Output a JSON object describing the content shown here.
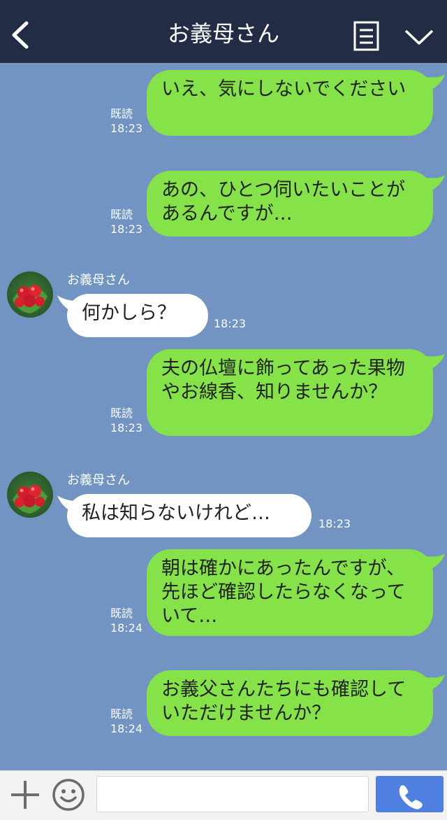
{
  "header": {
    "title": "お義母さん",
    "back_icon": "chevron-left-icon",
    "menu_icon": "notes-menu-icon",
    "more_icon": "chevron-down-icon"
  },
  "messages": [
    {
      "side": "me",
      "text": "いえ、気にしないでください",
      "read": "既読",
      "time": "18:23"
    },
    {
      "side": "me",
      "text": "あの、ひとつ伺いたいことがあるんですが…",
      "read": "既読",
      "time": "18:23"
    },
    {
      "side": "them",
      "sender": "お義母さん",
      "text": "何かしら？",
      "time": "18:23"
    },
    {
      "side": "me",
      "text": "夫の仏壇に飾ってあった果物やお線香、知りませんか？",
      "read": "既読",
      "time": "18:23"
    },
    {
      "side": "them",
      "sender": "お義母さん",
      "text": "私は知らないけれど…",
      "time": "18:23"
    },
    {
      "side": "me",
      "text": "朝は確かにあったんですが、先ほど確認したらなくなっていて…",
      "read": "既読",
      "time": "18:24"
    },
    {
      "side": "me",
      "text": "お義父さんたちにも確認していただけませんか？",
      "read": "既読",
      "time": "18:24"
    }
  ],
  "footer": {
    "plus_icon": "plus-icon",
    "emoji_icon": "emoji-icon",
    "input_value": "",
    "call_icon": "phone-icon"
  },
  "colors": {
    "background": "#7194c2",
    "header": "#222c45",
    "my_bubble": "#85e249",
    "their_bubble": "#ffffff",
    "call_button": "#4f7fe0"
  }
}
